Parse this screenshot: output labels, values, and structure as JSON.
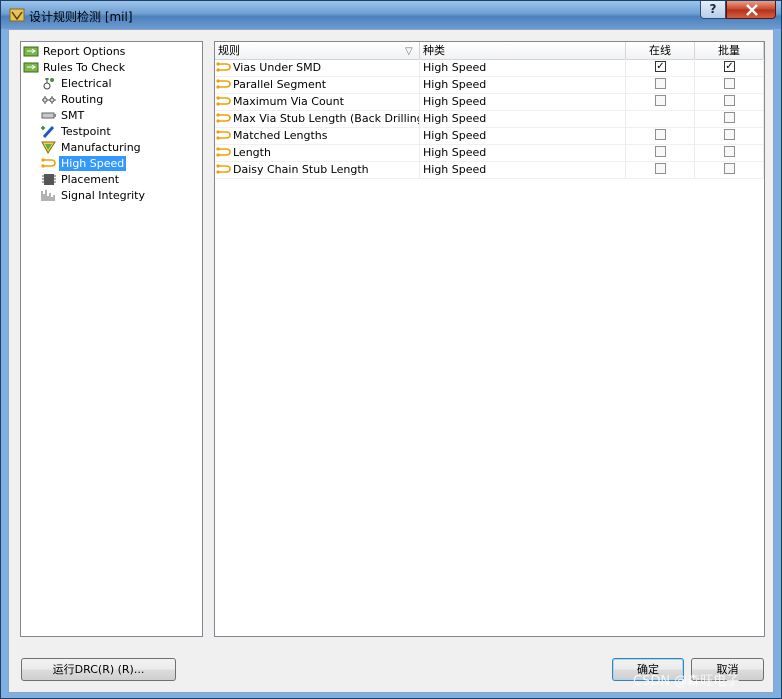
{
  "window": {
    "title": "设计规则检测 [mil]",
    "help_label": "?",
    "close_label": "✕"
  },
  "tree": {
    "items": [
      {
        "label": "Report Options",
        "icon": "report-options-icon",
        "level": 0
      },
      {
        "label": "Rules To Check",
        "icon": "rules-to-check-icon",
        "level": 0
      },
      {
        "label": "Electrical",
        "icon": "electrical-icon",
        "level": 1
      },
      {
        "label": "Routing",
        "icon": "routing-icon",
        "level": 1
      },
      {
        "label": "SMT",
        "icon": "smt-icon",
        "level": 1
      },
      {
        "label": "Testpoint",
        "icon": "testpoint-icon",
        "level": 1
      },
      {
        "label": "Manufacturing",
        "icon": "manufacturing-icon",
        "level": 1
      },
      {
        "label": "High Speed",
        "icon": "high-speed-icon",
        "level": 1,
        "selected": true
      },
      {
        "label": "Placement",
        "icon": "placement-icon",
        "level": 1
      },
      {
        "label": "Signal Integrity",
        "icon": "signal-integrity-icon",
        "level": 1
      }
    ]
  },
  "grid": {
    "columns": {
      "rule": "规则",
      "category": "种类",
      "online": "在线",
      "batch": "批量"
    },
    "rows": [
      {
        "rule": "Vias Under SMD",
        "category": "High Speed",
        "online": "checked",
        "batch": "checked"
      },
      {
        "rule": "Parallel Segment",
        "category": "High Speed",
        "online": "unchecked",
        "batch": "unchecked"
      },
      {
        "rule": "Maximum Via Count",
        "category": "High Speed",
        "online": "unchecked",
        "batch": "unchecked"
      },
      {
        "rule": "Max Via Stub Length (Back Drilling)",
        "category": "High Speed",
        "online": "none",
        "batch": "unchecked"
      },
      {
        "rule": "Matched Lengths",
        "category": "High Speed",
        "online": "unchecked",
        "batch": "unchecked"
      },
      {
        "rule": "Length",
        "category": "High Speed",
        "online": "unchecked",
        "batch": "unchecked"
      },
      {
        "rule": "Daisy Chain Stub Length",
        "category": "High Speed",
        "online": "unchecked",
        "batch": "unchecked"
      }
    ]
  },
  "buttons": {
    "run_drc": "运行DRC(R) (R)...",
    "ok": "确定",
    "cancel": "取消"
  },
  "watermark": "CSDN @森旺电子",
  "colors": {
    "selection": "#3399ff",
    "rule_icon": "#f0a000"
  }
}
